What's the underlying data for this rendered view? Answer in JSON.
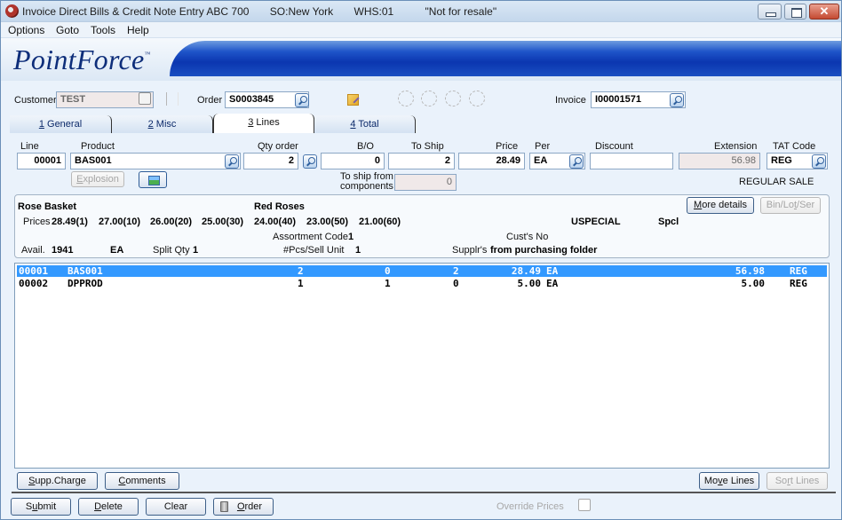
{
  "window": {
    "title": "Invoice Direct Bills & Credit Note Entry ABC 700",
    "so": "SO:New York",
    "whs": "WHS:01",
    "notice": "\"Not for resale\""
  },
  "menu": [
    "Options",
    "Goto",
    "Tools",
    "Help"
  ],
  "brand": {
    "logo": "PointForce",
    "tm": "™"
  },
  "header": {
    "customer_label": "Customer",
    "customer_value": "TEST",
    "order_label": "Order",
    "order_value": "S0003845",
    "invoice_label": "Invoice",
    "invoice_value": "I00001571"
  },
  "tabs": [
    {
      "key": "1",
      "rest": " General",
      "active": false
    },
    {
      "key": "2",
      "rest": " Misc",
      "active": false
    },
    {
      "key": "3",
      "rest": " Lines",
      "active": true
    },
    {
      "key": "4",
      "rest": " Total",
      "active": false
    }
  ],
  "line_entry": {
    "labels": {
      "line": "Line",
      "product": "Product",
      "qty_order": "Qty order",
      "bo": "B/O",
      "to_ship": "To Ship",
      "price": "Price",
      "per": "Per",
      "discount": "Discount",
      "extension": "Extension",
      "tat_code": "TAT Code",
      "to_ship_from_1": "To ship from",
      "to_ship_from_2": "components"
    },
    "values": {
      "line": "00001",
      "product": "BAS001",
      "qty_order": "2",
      "bo": "0",
      "to_ship": "2",
      "price": "28.49",
      "per": "EA",
      "discount": "",
      "extension": "56.98",
      "tat_code": "REG",
      "to_ship_from_components": "0"
    },
    "explosion_button": {
      "underline": "E",
      "rest": "xplosion"
    },
    "tat_description": "REGULAR SALE"
  },
  "info": {
    "product_name": "Rose Basket",
    "variant": "Red Roses",
    "prices_label": "Prices",
    "prices": [
      "28.49(1)",
      "27.00(10)",
      "26.00(20)",
      "25.00(30)",
      "24.00(40)",
      "23.00(50)",
      "21.00(60)"
    ],
    "special_code": "USPECIAL",
    "special_short": "Spcl",
    "more_details": {
      "underline": "M",
      "rest": "ore details"
    },
    "bin_lot_ser": {
      "pre": "Bin/Lo",
      "underline": "t",
      "rest": "/Ser"
    },
    "assortment_label": "Assortment Code",
    "assortment_value": "1",
    "cust_no_label": "Cust's No",
    "avail_label": "Avail.",
    "avail_value": "1941",
    "avail_unit": "EA",
    "split_qty_label": "Split Qty",
    "split_qty_value": "1",
    "pcs_label": "#Pcs/Sell Unit",
    "pcs_value": "1",
    "suppl_label": "Supplr's",
    "suppl_value": "from purchasing folder"
  },
  "lines": [
    {
      "line": "00001",
      "product": "BAS001",
      "qty": "2",
      "bo": "0",
      "ship": "2",
      "price": "28.49",
      "unit": "EA",
      "ext": "56.98",
      "tat": "REG",
      "selected": true
    },
    {
      "line": "00002",
      "product": "DPPROD",
      "qty": "1",
      "bo": "1",
      "ship": "0",
      "price": "5.00",
      "unit": "EA",
      "ext": "5.00",
      "tat": "REG",
      "selected": false
    }
  ],
  "grid_buttons": {
    "supp_charge": {
      "underline": "S",
      "rest": "upp.Charge"
    },
    "comments": {
      "underline": "C",
      "rest": "omments"
    },
    "move_lines": {
      "pre": "Mo",
      "underline": "v",
      "rest": "e Lines"
    },
    "sort_lines": {
      "pre": "So",
      "underline": "r",
      "rest": "t Lines"
    }
  },
  "footer": {
    "submit": {
      "pre": "S",
      "underline": "u",
      "rest": "bmit"
    },
    "delete": {
      "underline": "D",
      "rest": "elete"
    },
    "clear": "Clear",
    "order": {
      "underline": "O",
      "rest": "rder"
    },
    "override_prices_label": "Override Prices",
    "override_prices_checked": false
  }
}
